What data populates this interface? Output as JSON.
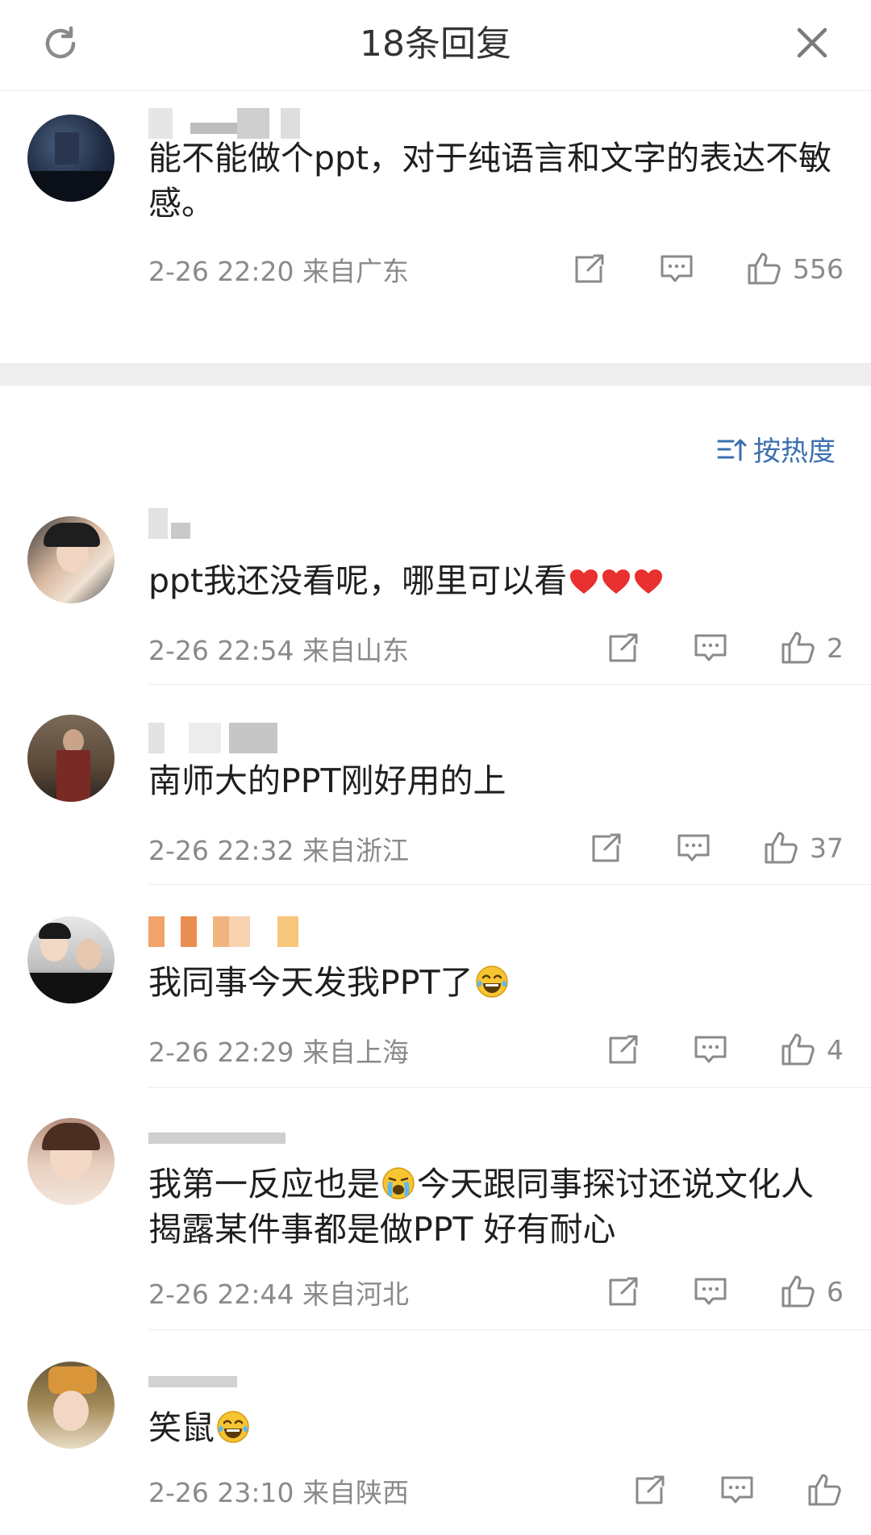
{
  "header": {
    "title": "18条回复"
  },
  "root_comment": {
    "text": "能不能做个ppt，对于纯语言和文字的表达不敏感。",
    "time": "2-26 22:20 来自广东",
    "likes": "556"
  },
  "sort": {
    "label": "按热度"
  },
  "replies": [
    {
      "text": "ppt我还没看呢，哪里可以看",
      "time": "2-26 22:54 来自山东",
      "likes": "2"
    },
    {
      "text": "南师大的PPT刚好用的上",
      "time": "2-26 22:32 来自浙江",
      "likes": "37"
    },
    {
      "text": "我同事今天发我PPT了",
      "time": "2-26 22:29 来自上海",
      "likes": "4"
    },
    {
      "text_a": "我第一反应也是",
      "text_b": "今天跟同事探讨还说文化人揭露某件事都是做PPT 好有耐心",
      "time": "2-26 22:44 来自河北",
      "likes": "6"
    },
    {
      "text": "笑鼠",
      "time": "2-26 23:10 来自陕西",
      "likes": ""
    }
  ],
  "colors": {
    "accent": "#3b6fb0",
    "meta": "#8a8a8a",
    "heart": "#e8302f"
  },
  "icons": [
    "refresh-icon",
    "close-icon",
    "share-icon",
    "comment-icon",
    "like-icon",
    "sort-icon",
    "heart-emoji",
    "laugh-cry-emoji",
    "loudly-crying-emoji"
  ]
}
